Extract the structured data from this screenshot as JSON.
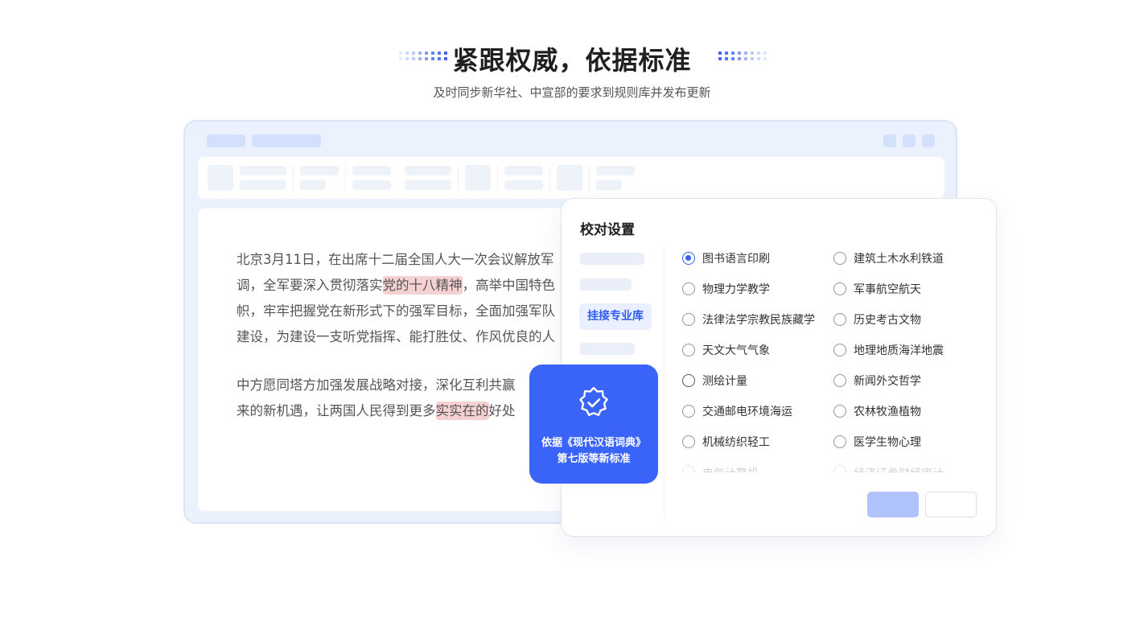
{
  "hero": {
    "title": "紧跟权威，依据标准",
    "subtitle": "及时同步新华社、中宣部的要求到规则库并发布更新"
  },
  "document": {
    "paragraph1": [
      [
        "北京3月11日，在出席十二届全国人大一次会议解放军"
      ],
      [
        "调，全军要深入贯彻落实",
        "党的十八精神",
        "，高举中国特色"
      ],
      [
        "帜，牢牢把握党在新形式下的强军目标，全面加强军队"
      ],
      [
        "建设，为建设一支听党指挥、能打胜仗、作风优良的人"
      ]
    ],
    "paragraph2": [
      [
        "中方愿同塔方加强发展战略对接，深化互利共赢"
      ],
      [
        "来的新机遇，让两国人民得到更多",
        "实实在的",
        "好处"
      ]
    ]
  },
  "settings_panel": {
    "title": "校对设置",
    "active_nav": "挂接专业库",
    "options_left": [
      {
        "label": "图书语言印刷",
        "selected": true
      },
      {
        "label": "物理力学教学",
        "selected": false
      },
      {
        "label": "法律法学宗教民族藏学",
        "selected": false
      },
      {
        "label": "天文大气气象",
        "selected": false
      },
      {
        "label": "测绘计量",
        "selected": false
      },
      {
        "label": "交通邮电环境海运",
        "selected": false
      },
      {
        "label": "机械纺织轻工",
        "selected": false
      },
      {
        "label": "电气计算机",
        "selected": false
      }
    ],
    "options_right": [
      {
        "label": "建筑土木水利铁道",
        "selected": false
      },
      {
        "label": "军事航空航天",
        "selected": false
      },
      {
        "label": "历史考古文物",
        "selected": false
      },
      {
        "label": "地理地质海洋地震",
        "selected": false
      },
      {
        "label": "新闻外交哲学",
        "selected": false
      },
      {
        "label": "农林牧渔植物",
        "selected": false
      },
      {
        "label": "医学生物心理",
        "selected": false
      },
      {
        "label": "经济证券财经审计",
        "selected": false
      }
    ]
  },
  "badge": {
    "icon": "verified-badge-icon",
    "line1": "依据《现代汉语词典》",
    "line2": "第七版等新标准"
  },
  "colors": {
    "accent": "#3a63f8",
    "highlight": "#f6d1d3",
    "window_bg": "#ecf2fd"
  }
}
